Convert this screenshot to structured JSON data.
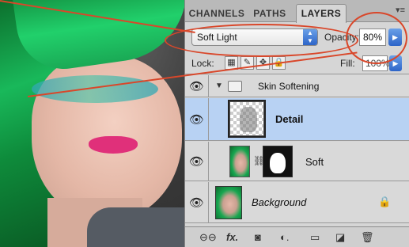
{
  "tabs": {
    "channels": "CHANNELS",
    "paths": "PATHS",
    "layers": "LAYERS"
  },
  "blend": {
    "mode": "Soft Light",
    "opacity_label": "Opacity:",
    "opacity_value": "80%"
  },
  "lock": {
    "label": "Lock:",
    "fill_label": "Fill:",
    "fill_value": "100%"
  },
  "layers": {
    "group": {
      "name": "Skin Softening"
    },
    "detail": {
      "name": "Detail"
    },
    "soft": {
      "name": "Soft"
    },
    "background": {
      "name": "Background"
    }
  },
  "accent": "#d9472a"
}
